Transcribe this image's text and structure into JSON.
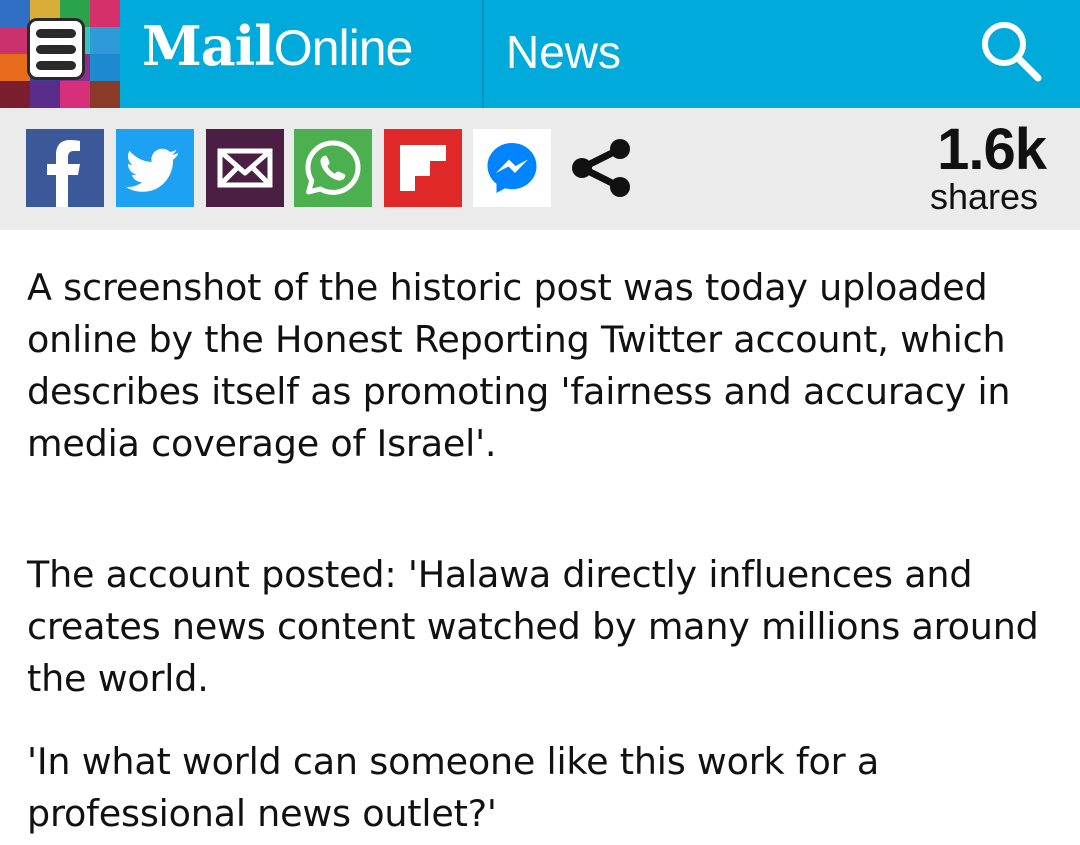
{
  "header": {
    "brand_mail": "Mail",
    "brand_online": "Online",
    "section": "News",
    "background_color": "#00AADB",
    "menu_icon": "hamburger-menu-icon",
    "search_icon": "search-icon"
  },
  "share_bar": {
    "buttons": [
      {
        "name": "facebook",
        "icon": "facebook-icon",
        "color": "#3B5998"
      },
      {
        "name": "twitter",
        "icon": "twitter-icon",
        "color": "#1DA1F2"
      },
      {
        "name": "email",
        "icon": "email-icon",
        "color": "#4B1F43"
      },
      {
        "name": "whatsapp",
        "icon": "whatsapp-icon",
        "color": "#4CAF50"
      },
      {
        "name": "flipboard",
        "icon": "flipboard-icon",
        "color": "#E12828"
      },
      {
        "name": "messenger",
        "icon": "messenger-icon",
        "color": "#0084FF"
      },
      {
        "name": "share",
        "icon": "share-icon",
        "color": "#111111"
      }
    ],
    "share_count": "1.6k",
    "share_label": "shares"
  },
  "article": {
    "paragraphs": [
      "A screenshot of the historic post was today uploaded online by the Honest Reporting Twitter account, which describes itself as promoting 'fairness and accuracy in media coverage of Israel'.",
      "The account posted: 'Halawa directly influences and creates news content watched by many millions around the world.",
      "'In what world can someone like this work for a professional news outlet?'"
    ]
  }
}
